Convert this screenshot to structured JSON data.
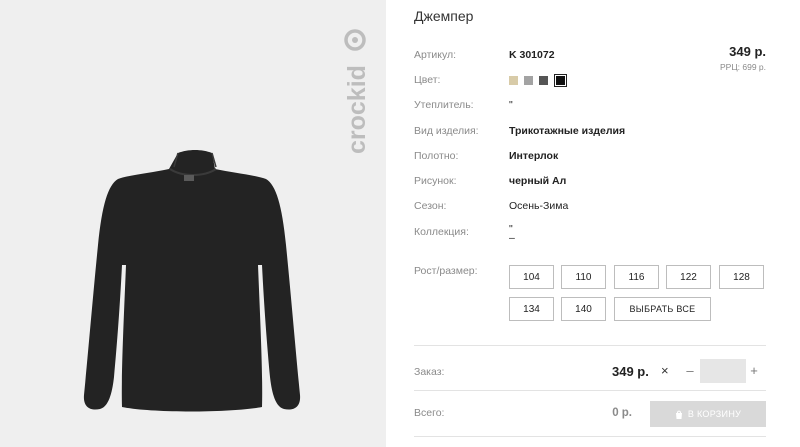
{
  "product": {
    "title": "Джемпер",
    "price": "349 р.",
    "rrc": "РРЦ: 699 р.",
    "brand_logo": "crockid",
    "colors": [
      "#d8cba8",
      "#a3a3a3",
      "#555555",
      "#111111"
    ],
    "specs": [
      {
        "label": "Артикул:",
        "value": "K 301072"
      },
      {
        "label": "Цвет:",
        "value": ""
      },
      {
        "label": "Утеплитель:",
        "value": "\""
      },
      {
        "label": "Вид изделия:",
        "value": "Трикотажные изделия"
      },
      {
        "label": "Полотно:",
        "value": "Интерлок"
      },
      {
        "label": "Рисунок:",
        "value": "черный Ал"
      },
      {
        "label": "Сезон:",
        "value": "Осень-Зима"
      },
      {
        "label": "Коллекция:",
        "value": "\""
      }
    ],
    "collection_dash": "–"
  },
  "sizes": {
    "label": "Рост/размер:",
    "options": [
      "104",
      "110",
      "116",
      "122",
      "128",
      "134",
      "140"
    ],
    "select_all": "ВЫБРАТЬ ВСЕ"
  },
  "order": {
    "label": "Заказ:",
    "price": "349 р.",
    "times": "×",
    "minus": "–",
    "plus": "+",
    "quantity": ""
  },
  "total": {
    "label": "Всего:",
    "value": "0 р.",
    "cart_button": "В КОРЗИНУ"
  }
}
